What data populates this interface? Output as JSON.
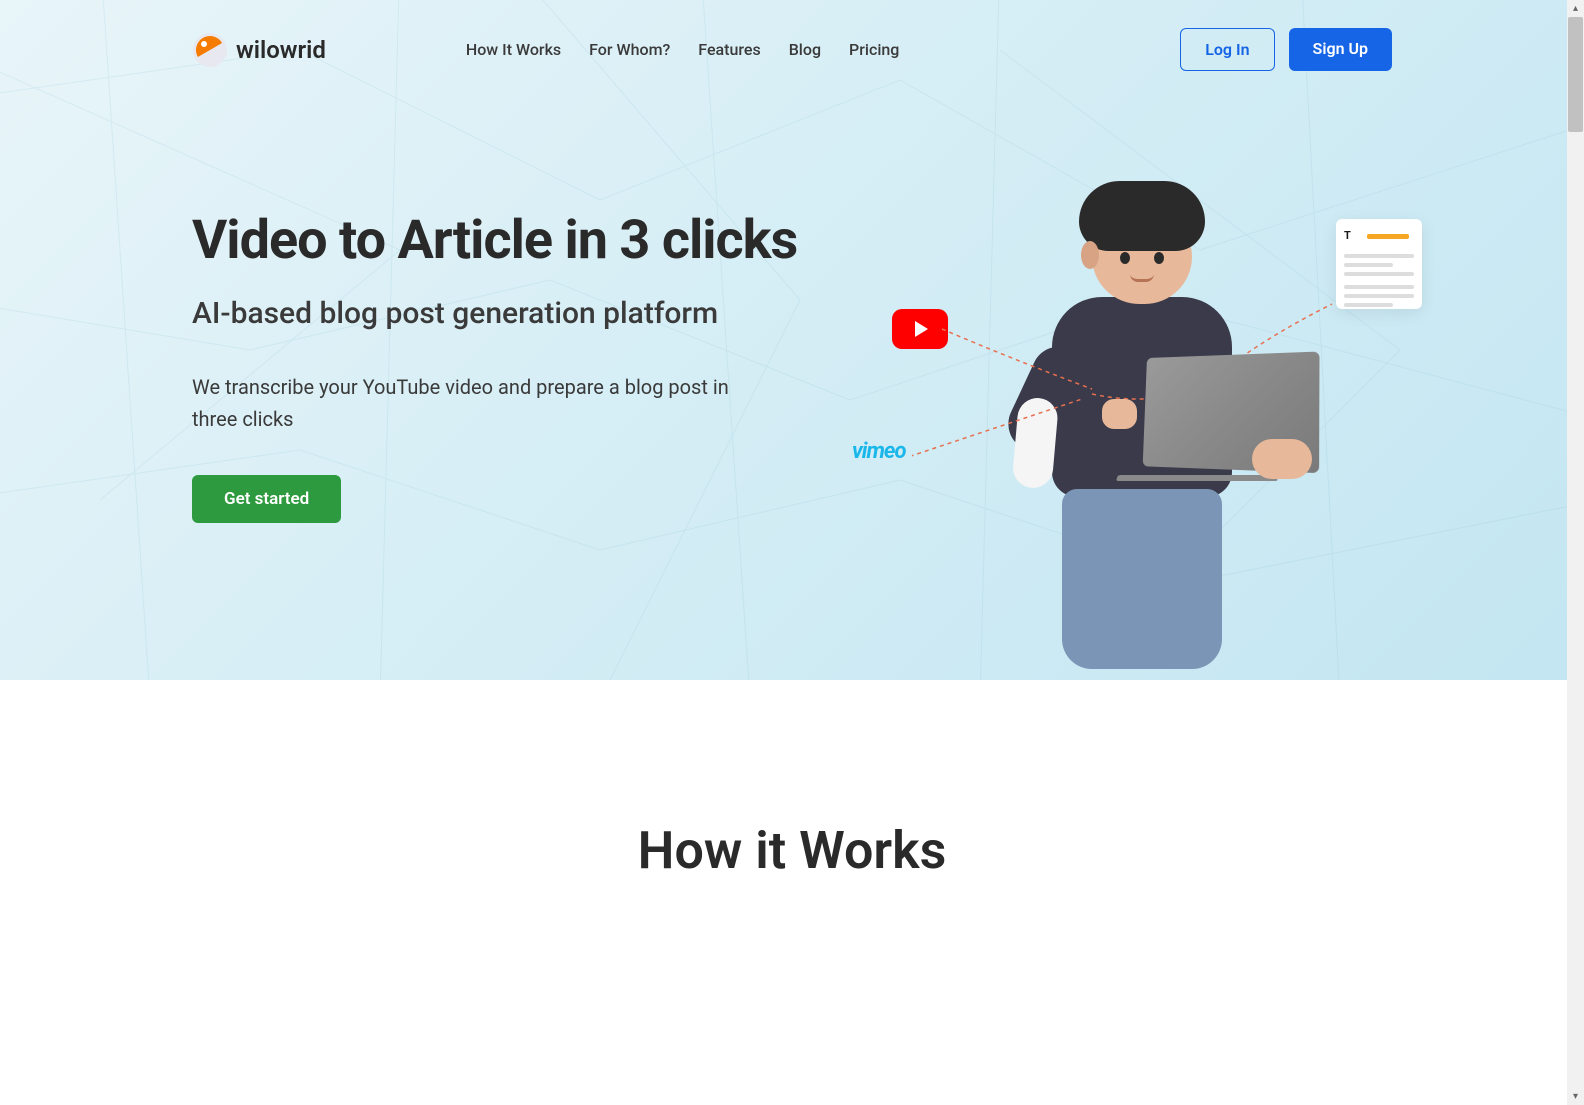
{
  "brand": {
    "name": "wilowrid"
  },
  "nav": {
    "links": [
      {
        "label": "How It Works"
      },
      {
        "label": "For Whom?"
      },
      {
        "label": "Features"
      },
      {
        "label": "Blog"
      },
      {
        "label": "Pricing"
      }
    ],
    "login": "Log In",
    "signup": "Sign Up"
  },
  "hero": {
    "title": "Video to Article in 3 clicks",
    "subtitle": "AI-based blog post generation platform",
    "description": "We transcribe your YouTube video and prepare a blog post in three clicks",
    "cta": "Get started",
    "vimeo_label": "vimeo",
    "doc_letter": "T"
  },
  "section2": {
    "title": "How it Works"
  }
}
